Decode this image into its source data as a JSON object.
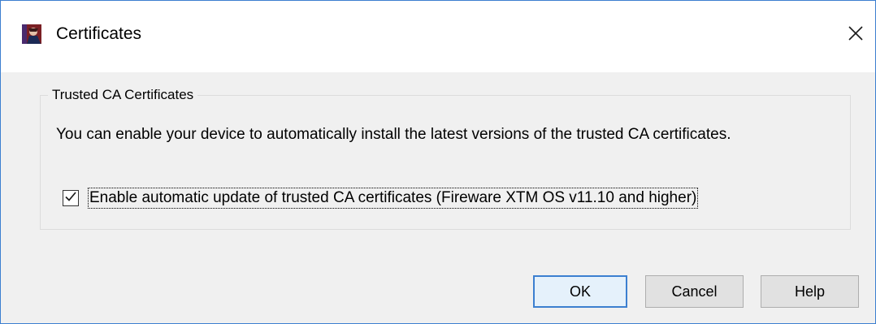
{
  "window": {
    "title": "Certificates",
    "icon": "watchguard-app-icon",
    "close_icon": "close-icon"
  },
  "group": {
    "legend": "Trusted CA Certificates",
    "description": "You can enable your device to automatically install the latest versions of the trusted CA certificates.",
    "checkbox": {
      "label": "Enable automatic update of trusted CA certificates (Fireware XTM OS v11.10 and higher)",
      "checked": true
    }
  },
  "buttons": {
    "ok": "OK",
    "cancel": "Cancel",
    "help": "Help"
  },
  "colors": {
    "accent": "#3c7fd0",
    "dialog_bg": "#f0f0f0",
    "button_bg": "#e1e1e1"
  }
}
